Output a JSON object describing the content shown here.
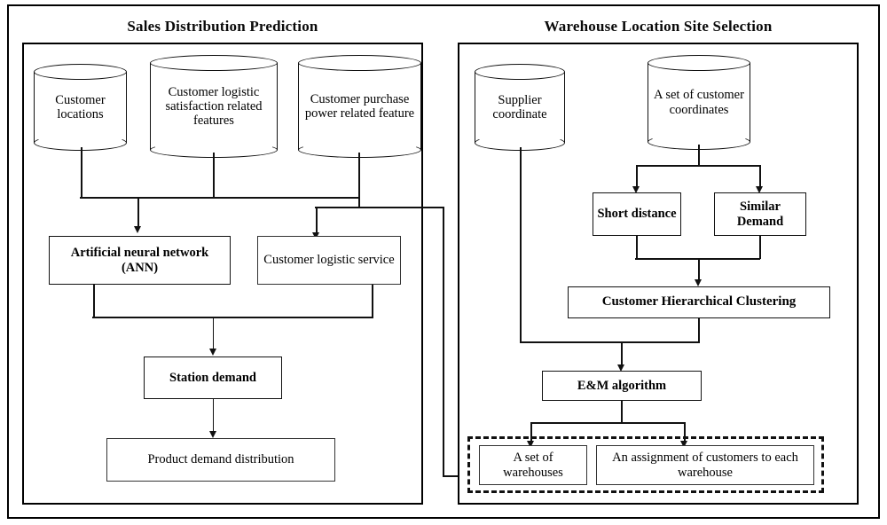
{
  "figure": {
    "panels": [
      {
        "id": "sales",
        "title": "Sales Distribution Prediction",
        "data_sources": [
          {
            "id": "customer-locations",
            "label": "Customer locations"
          },
          {
            "id": "customer-logistic-satisfaction",
            "label": "Customer logistic satisfaction related features"
          },
          {
            "id": "customer-purchase-power",
            "label": "Customer purchase power related feature"
          }
        ],
        "process_nodes": [
          {
            "id": "ann",
            "label": "Artificial neural network (ANN)",
            "bold": true
          },
          {
            "id": "customer-logistic-service",
            "label": "Customer logistic service",
            "bold": false
          },
          {
            "id": "station-demand",
            "label": "Station demand",
            "bold": true
          },
          {
            "id": "product-demand-distribution",
            "label": "Product demand distribution",
            "bold": false
          }
        ]
      },
      {
        "id": "warehouse",
        "title": "Warehouse Location Site Selection",
        "data_sources": [
          {
            "id": "supplier-coordinate",
            "label": "Supplier coordinate"
          },
          {
            "id": "customer-coordinates",
            "label": "A set of customer coordinates"
          }
        ],
        "process_nodes": [
          {
            "id": "short-distance",
            "label": "Short distance",
            "bold": true
          },
          {
            "id": "similar-demand",
            "label": "Similar Demand",
            "bold": true
          },
          {
            "id": "customer-hierarchical-clustering",
            "label": "Customer Hierarchical Clustering",
            "bold": true
          },
          {
            "id": "em-algorithm",
            "label": "E&M algorithm",
            "bold": true
          }
        ],
        "output_group": {
          "id": "warehouse-outputs",
          "style": "dashed",
          "items": [
            {
              "id": "set-of-warehouses",
              "label": "A set of warehouses"
            },
            {
              "id": "assignment-of-customers",
              "label": "An assignment of customers to each warehouse"
            }
          ]
        }
      }
    ],
    "colors": {
      "stroke": "#111111",
      "background": "#ffffff",
      "text": "#000000"
    }
  }
}
